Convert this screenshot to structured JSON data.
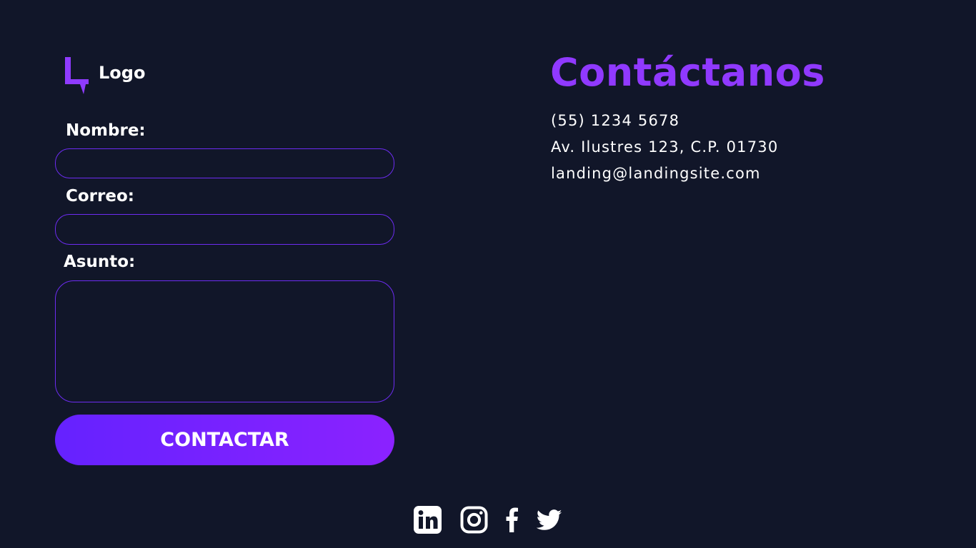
{
  "logo": {
    "text": "Logo",
    "mark_icon": "logo-l-icon",
    "accent_color": "#8f3bff"
  },
  "form": {
    "name_label": "Nombre:",
    "name_value": "",
    "email_label": "Correo:",
    "email_value": "",
    "subject_label": "Asunto:",
    "subject_value": "",
    "submit_label": "CONTACTAR",
    "border_color": "#6d2cf2",
    "button_gradient": [
      "#6522ff",
      "#8b22ff"
    ]
  },
  "contact": {
    "title": "Contáctanos",
    "title_color": "#9039ff",
    "phone": "(55) 1234 5678",
    "address": "Av. Ilustres 123, C.P. 01730",
    "email": "landing@landingsite.com"
  },
  "social": [
    {
      "name": "linkedin",
      "icon": "linkedin-icon"
    },
    {
      "name": "instagram",
      "icon": "instagram-icon"
    },
    {
      "name": "facebook",
      "icon": "facebook-icon"
    },
    {
      "name": "twitter",
      "icon": "twitter-icon"
    }
  ],
  "colors": {
    "background": "#111629",
    "text": "#ffffff"
  }
}
